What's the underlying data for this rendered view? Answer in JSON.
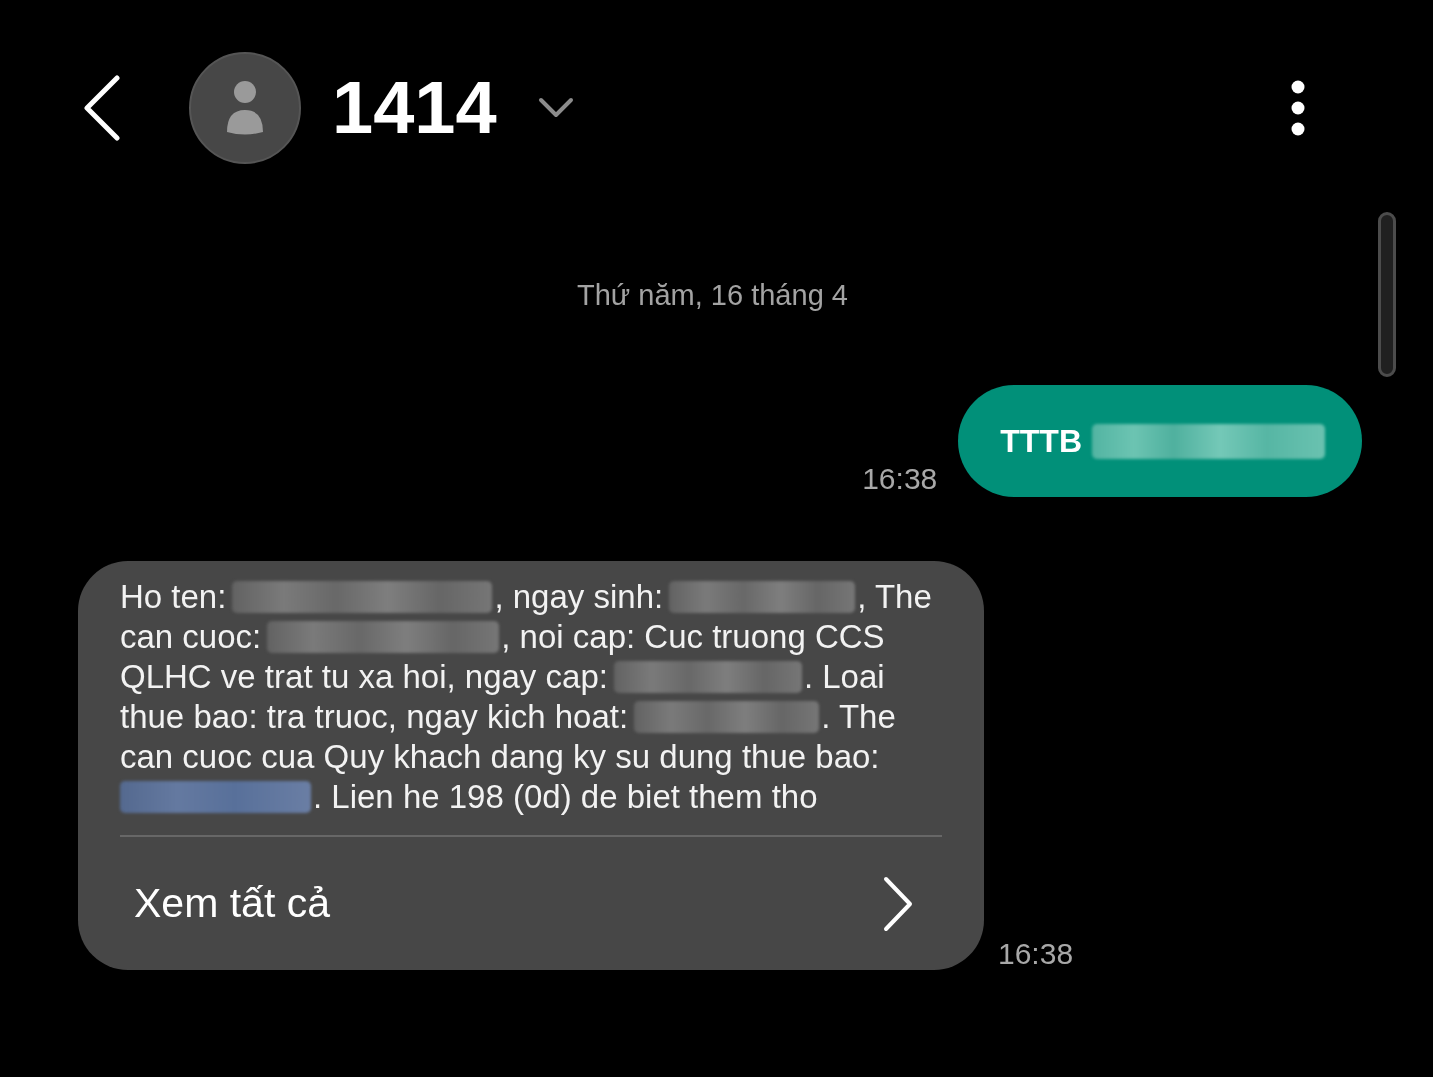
{
  "header": {
    "title": "1414"
  },
  "date_separator": "Thứ năm, 16 tháng 4",
  "messages": [
    {
      "kind": "sent",
      "time": "16:38",
      "lines": [
        {
          "segments": [
            {
              "kind": "text",
              "text": "TTTB"
            },
            {
              "kind": "blur"
            }
          ]
        }
      ]
    },
    {
      "kind": "received",
      "time": "16:38",
      "lines": [
        {
          "segments": [
            {
              "kind": "text",
              "text": "Ho ten:"
            },
            {
              "kind": "blur"
            },
            {
              "kind": "text",
              "text": ", ngay sinh:"
            },
            {
              "kind": "blur"
            },
            {
              "kind": "text",
              "text": ", The"
            }
          ]
        },
        {
          "segments": [
            {
              "kind": "text",
              "text": "can cuoc:"
            },
            {
              "kind": "blur"
            },
            {
              "kind": "text",
              "text": ", noi cap: Cuc truong CCS"
            }
          ]
        },
        {
          "segments": [
            {
              "kind": "text",
              "text": "QLHC ve trat tu xa hoi, ngay cap:"
            },
            {
              "kind": "blur"
            },
            {
              "kind": "text",
              "text": ". Loai"
            }
          ]
        },
        {
          "segments": [
            {
              "kind": "text",
              "text": "thue bao: tra truoc, ngay kich hoat:"
            },
            {
              "kind": "blur"
            },
            {
              "kind": "text",
              "text": ". The"
            }
          ]
        },
        {
          "segments": [
            {
              "kind": "text",
              "text": "can cuoc cua Quy khach dang ky su dung thue bao:"
            }
          ]
        },
        {
          "segments": [
            {
              "kind": "blurlink"
            },
            {
              "kind": "text",
              "text": ". Lien he 198 (0d) de biet them tho"
            }
          ]
        }
      ],
      "more_link": "Xem tất cả"
    }
  ]
}
